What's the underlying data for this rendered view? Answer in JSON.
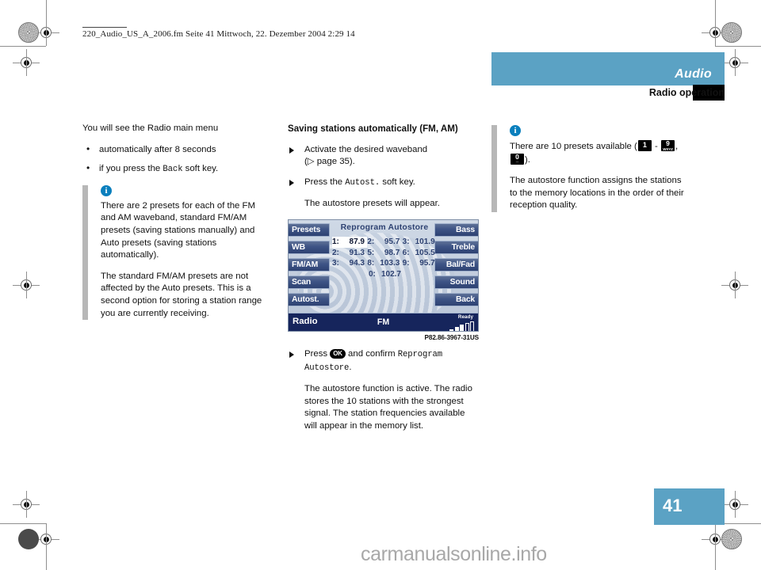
{
  "print_header": {
    "filename_line": "220_Audio_US_A_2006.fm  Seite 41  Mittwoch, 22. Dezember 2004  2:29 14"
  },
  "header": {
    "section_label": "Audio",
    "subsection_label": "Radio operation"
  },
  "footer": {
    "page_number": "41",
    "watermark": "carmanualsonline.info"
  },
  "left_column": {
    "intro": "You will see the Radio main menu",
    "bullets": [
      {
        "bullet": "•",
        "text_before": "automatically after 8 seconds",
        "mono": "",
        "text_after": ""
      },
      {
        "bullet": "•",
        "text_before": "if you press the ",
        "mono": "Back",
        "text_after": " soft key."
      }
    ],
    "note": {
      "icon": "info-icon",
      "paragraph_1": "There are 2 presets for each of the FM and AM waveband, standard FM/AM presets (saving stations manually) and Auto presets (saving stations automatically).",
      "paragraph_2": "The standard FM/AM presets are not affected by the Auto presets. This is a second option for storing a station range you are currently receiving."
    }
  },
  "middle_column": {
    "heading": "Saving stations automatically (FM, AM)",
    "step_1": {
      "text_before": "Activate the desired waveband",
      "cross_ref": "(▷ page 35)."
    },
    "step_2": {
      "text_before": "Press the ",
      "mono": "Autost.",
      "text_after": " soft key."
    },
    "step_2_result": "The autostore presets will appear.",
    "step_3": {
      "text_before": "Press ",
      "ok_glyph": "OK",
      "text_mid": " and confirm ",
      "mono": "Reprogram Autostore",
      "text_after": "."
    },
    "step_3_result": "The autostore function is active. The radio stores the 10 stations with the strongest signal. The station frequencies available will appear in the memory list.",
    "figure_caption": "P82.86-3967-31US"
  },
  "right_column": {
    "note": {
      "icon": "info-icon",
      "paragraph_1_before": "There are 10 presets available (",
      "key_1": {
        "main": "1",
        "sub": ""
      },
      "dash": " - ",
      "key_9": {
        "main": "9",
        "sub": "WXYZ"
      },
      "comma": ", ",
      "key_0": {
        "main": "0",
        "sub": "_"
      },
      "paragraph_1_after": ").",
      "paragraph_2": "The autostore function assigns the stations to the memory locations in the order of their reception quality."
    }
  },
  "radio_display": {
    "title": "Reprogram Autostore",
    "left_softkeys": [
      "Presets",
      "WB",
      "FM/AM",
      "Scan",
      "Autost."
    ],
    "right_softkeys": [
      "Bass",
      "Treble",
      "Bal/Fad",
      "Sound",
      "Back"
    ],
    "preset_rows": [
      [
        {
          "num": "1:",
          "freq": "87.9",
          "selected": true
        },
        {
          "num": "2:",
          "freq": "95.7",
          "selected": false
        },
        {
          "num": "3:",
          "freq": "101.9",
          "selected": false
        }
      ],
      [
        {
          "num": "2:",
          "freq": "91.3",
          "selected": false
        },
        {
          "num": "5:",
          "freq": "98.7",
          "selected": false
        },
        {
          "num": "6:",
          "freq": "105.5",
          "selected": false
        }
      ],
      [
        {
          "num": "3:",
          "freq": "94.3",
          "selected": false
        },
        {
          "num": "8:",
          "freq": "103.3",
          "selected": false
        },
        {
          "num": "9:",
          "freq": "95.7",
          "selected": false
        }
      ]
    ],
    "preset_last_row": [
      {
        "num": "0:",
        "freq": "102.7",
        "selected": false
      }
    ],
    "status_bar": {
      "source": "Radio",
      "band": "FM",
      "ready_label": "Ready"
    }
  },
  "colors": {
    "accent_blue": "#5ba2c4",
    "info_blue": "#0a7fbd",
    "display_navy": "#2e4272",
    "status_navy": "#16255c"
  }
}
